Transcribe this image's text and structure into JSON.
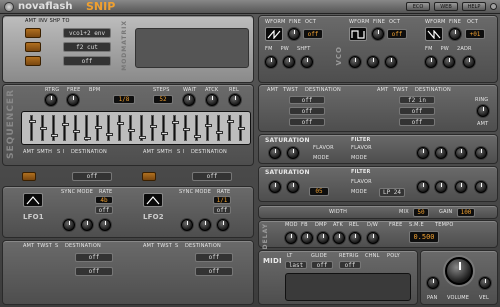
{
  "topbar": {
    "brand": "novaflash",
    "product": "SNIP",
    "buttons": [
      "ECO",
      "WEB",
      "HELP"
    ]
  },
  "modmatrix": {
    "headers": [
      "AMT",
      "INV",
      "SHP",
      "TO"
    ],
    "rows": [
      {
        "amt": "0.00",
        "to": "vco1+2 env"
      },
      {
        "amt": "0.00",
        "to": "f2 cut"
      },
      {
        "amt": "0.00",
        "to": "off"
      }
    ],
    "side": "MODMATRIX"
  },
  "vco": [
    {
      "labels": [
        "WFORM",
        "FINE",
        "OCT"
      ],
      "oct": "off",
      "sub": [
        "FM",
        "PW",
        "SHFT"
      ],
      "name": "VCO"
    },
    {
      "labels": [
        "WFORM",
        "FINE",
        "OCT"
      ],
      "oct": "off",
      "sub": [
        "FM",
        "PW",
        "SHFT"
      ]
    },
    {
      "labels": [
        "WFORM",
        "FINE",
        "OCT"
      ],
      "oct": "+01",
      "sub": [
        "FM",
        "PW",
        "2ADR"
      ]
    }
  ],
  "sequencer": {
    "side": "SEQUENCER",
    "labels": [
      "RTRG",
      "FREE",
      "BPM",
      "STEPS",
      "WAIT",
      "ATCK",
      "REL"
    ],
    "bpm": "1/8",
    "steps": "52",
    "mod_headers": [
      "AMT",
      "SMTH",
      "S",
      "I",
      "DESTINATION"
    ],
    "dest": [
      "off",
      "off"
    ]
  },
  "envs": {
    "headers": [
      "AMT",
      "TWST",
      "DESTINATION"
    ],
    "rows": [
      "off",
      "off",
      "off"
    ],
    "right_rows": [
      "f2 in",
      "off",
      "off"
    ],
    "ring": "RING",
    "amt": "AMT"
  },
  "saturation": {
    "title": "SATURATION",
    "labels": [
      "FLAVOR",
      "MODE"
    ],
    "mode_value": "05"
  },
  "filters": [
    {
      "title": "FILTER",
      "labels": [
        "FLAVOR",
        "MODE",
        "CUT",
        "RES",
        "KT",
        "VEL"
      ],
      "mode_value": ""
    },
    {
      "title": "FILTER",
      "labels": [
        "FLAVOR",
        "MODE",
        "CUT",
        "RES",
        "KT",
        "VEL"
      ],
      "mode_value": "LP 24"
    }
  ],
  "lfos": [
    {
      "name": "LFO1",
      "labels": [
        "SYNC",
        "MODE",
        "RATE",
        "WAIT",
        "ATCK",
        "REL"
      ],
      "rate": "4b",
      "mode": "off"
    },
    {
      "name": "LFO2",
      "labels": [
        "SYNC",
        "MODE",
        "RATE",
        "WAIT",
        "ATCK",
        "REL"
      ],
      "rate": "1/1",
      "mode": "off"
    }
  ],
  "lfo_mod": {
    "headers": [
      "AMT",
      "SMTH",
      "S",
      "I",
      "DESTINATION"
    ],
    "rows": [
      "off",
      "off",
      "off",
      "off"
    ]
  },
  "lfo_env": {
    "headers": [
      "AMT",
      "TWST",
      "S",
      "DESTINATION"
    ],
    "rows": [
      "off",
      "off",
      "off",
      "off"
    ]
  },
  "output": {
    "labels": [
      "WIDTH",
      "MIX",
      "GAIN"
    ],
    "mix": "50",
    "gain": "100"
  },
  "delay": {
    "side": "DELAY",
    "labels": [
      "MOD",
      "FB",
      "DMP",
      "ATK",
      "REL",
      "D/W",
      "FREE",
      "S.M.E",
      "TEMPO"
    ],
    "time": "0.500"
  },
  "midi": {
    "label": "MIDI",
    "items": [
      "LT",
      "GLIDE",
      "RETRIG",
      "CHNL",
      "POLY"
    ],
    "vals": [
      "last",
      "off",
      "off"
    ]
  },
  "master": {
    "labels": [
      "PAN",
      "VOLUME",
      "VEL"
    ]
  }
}
